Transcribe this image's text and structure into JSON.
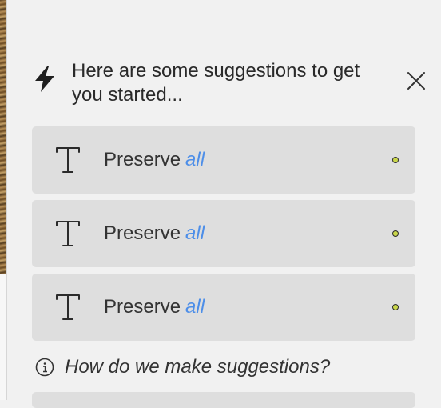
{
  "header": {
    "icon": "lightning-bolt-icon",
    "text": "Here are some suggestions to get you started..."
  },
  "close": {
    "icon": "close-icon"
  },
  "suggestions": [
    {
      "icon": "text-type-icon",
      "label": "Preserve",
      "scope": "all",
      "status_color": "#c9d64a"
    },
    {
      "icon": "text-type-icon",
      "label": "Preserve",
      "scope": "all",
      "status_color": "#c9d64a"
    },
    {
      "icon": "text-type-icon",
      "label": "Preserve",
      "scope": "all",
      "status_color": "#c9d64a"
    }
  ],
  "help": {
    "icon": "info-icon",
    "text": "How do we make suggestions?"
  },
  "colors": {
    "panel_background": "#f1f1f1",
    "card_background": "#dedede",
    "accent": "#4d8ee8"
  }
}
